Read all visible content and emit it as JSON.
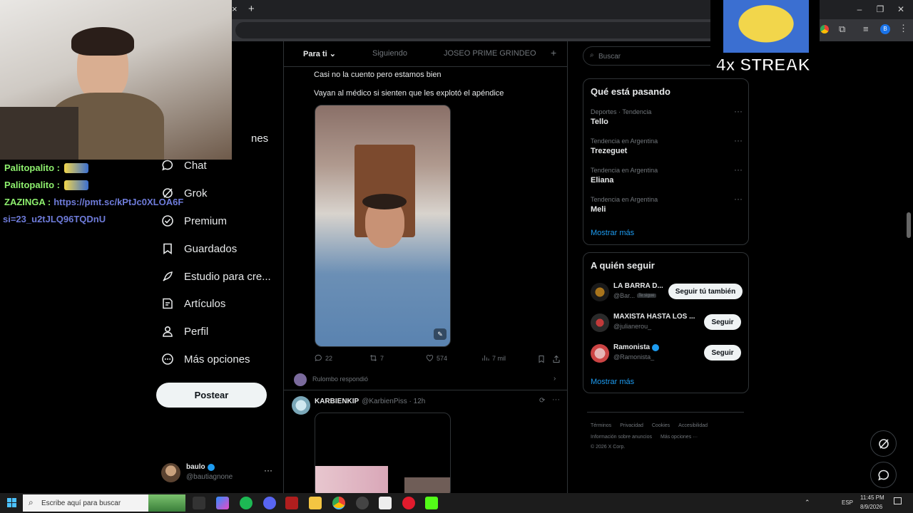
{
  "browser": {
    "new_tab": "+",
    "close_tab": "×"
  },
  "feed_tabs": [
    {
      "label": "Para ti"
    },
    {
      "label": "Siguiendo"
    },
    {
      "label": "JOSEO PRIME GRINDEO"
    },
    {
      "label": "+"
    }
  ],
  "nav": [
    {
      "label": "nes",
      "icon": "notifications-icon"
    },
    {
      "label": "Chat",
      "icon": "chat-icon"
    },
    {
      "label": "Grok",
      "icon": "grok-icon"
    },
    {
      "label": "Premium",
      "icon": "premium-icon"
    },
    {
      "label": "Guardados",
      "icon": "bookmark-icon"
    },
    {
      "label": "Estudio para cre...",
      "icon": "rocket-icon"
    },
    {
      "label": "Artículos",
      "icon": "article-icon"
    },
    {
      "label": "Perfil",
      "icon": "person-icon"
    },
    {
      "label": "Más opciones",
      "icon": "more-circle-icon"
    }
  ],
  "post_button": "Postear",
  "account": {
    "name": "baulo",
    "handle": "@bautiagnone",
    "more": "···"
  },
  "tweet1": {
    "line1": "Casi no la cuento pero estamos bien",
    "line2": "Vayan al médico si sienten que les explotó el apéndice",
    "replies": "22",
    "retweets": "7",
    "likes": "574",
    "views": "7 mil",
    "replied_by": "Rulombo respondió"
  },
  "tweet2": {
    "name": "KARBIENKIP",
    "meta": "@KarbienPiss · 12h",
    "more": "···"
  },
  "search": {
    "placeholder": "Buscar"
  },
  "trends": {
    "title": "Qué está pasando",
    "items": [
      {
        "category": "Deportes · Tendencia",
        "name": "Tello"
      },
      {
        "category": "Tendencia en Argentina",
        "name": "Trezeguet"
      },
      {
        "category": "Tendencia en Argentina",
        "name": "Eliana"
      },
      {
        "category": "Tendencia en Argentina",
        "name": "Meli"
      }
    ],
    "more": "Mostrar más"
  },
  "who_to_follow": {
    "title": "A quién seguir",
    "items": [
      {
        "name": "LA BARRA D...",
        "handle": "@Bar...",
        "badge": "Te sigue",
        "button": "Seguir tú también"
      },
      {
        "name": "MAXISTA HASTA LOS ...",
        "handle": "@julianerou_",
        "button": "Seguir"
      },
      {
        "name": "Ramonista",
        "handle": "@Ramonista_",
        "button": "Seguir"
      }
    ],
    "more": "Mostrar más"
  },
  "footer": {
    "line1": [
      "Términos",
      "Privacidad",
      "Cookies",
      "Accesibilidad"
    ],
    "line2": [
      "Información sobre anuncios",
      "Más opciones ···"
    ],
    "copyright": "© 2026 X Corp."
  },
  "overlay": {
    "streak": "4x STREAK"
  },
  "stream_chat": [
    {
      "user": "Palitopalito :"
    },
    {
      "user": "Palitopalito :"
    },
    {
      "user": "ZAZINGA :",
      "text": "https://pmt.sc/kPtJc0XLOA6F"
    },
    {
      "text": "si=23_u2tJLQ96TQDnU"
    }
  ],
  "taskbar": {
    "search": "Escribe aquí para buscar",
    "lang": "ESP",
    "time": "11:45 PM",
    "date": "8/9/2026"
  },
  "colors": {
    "accent": "#1d9bf0",
    "chat_name": "#8ef06e",
    "chat_link": "#6e7bd9"
  }
}
